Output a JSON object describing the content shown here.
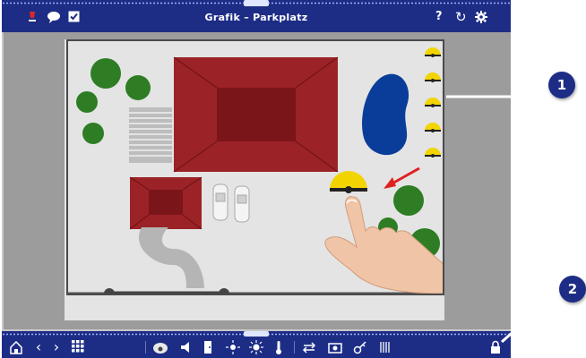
{
  "header": {
    "title": "Grafik – Parkplatz",
    "left_icons": [
      "lamp-icon",
      "chat-icon",
      "checkbox-icon"
    ],
    "right_icons": [
      "help-icon",
      "refresh-icon",
      "settings-icon"
    ],
    "help_glyph": "?",
    "refresh_glyph": "↻"
  },
  "toolbar": {
    "icons": [
      "home-icon",
      "back-icon",
      "forward-icon",
      "grid-icon",
      "security-camera-icon",
      "speaker-icon",
      "door-icon",
      "light-icon",
      "sun-icon",
      "thermometer-icon",
      "repeat-icon",
      "camera-icon",
      "key-icon",
      "gate-icon",
      "lock-icon"
    ],
    "back_glyph": "‹",
    "forward_glyph": "›"
  },
  "callouts": [
    {
      "label": "1"
    },
    {
      "label": "2"
    }
  ],
  "colors": {
    "bar": "#1d2d86",
    "building": "#9b2226",
    "tree": "#2e7d24",
    "pond": "#0a3d9a",
    "light": "#f2d500",
    "arrow": "#e02020"
  }
}
